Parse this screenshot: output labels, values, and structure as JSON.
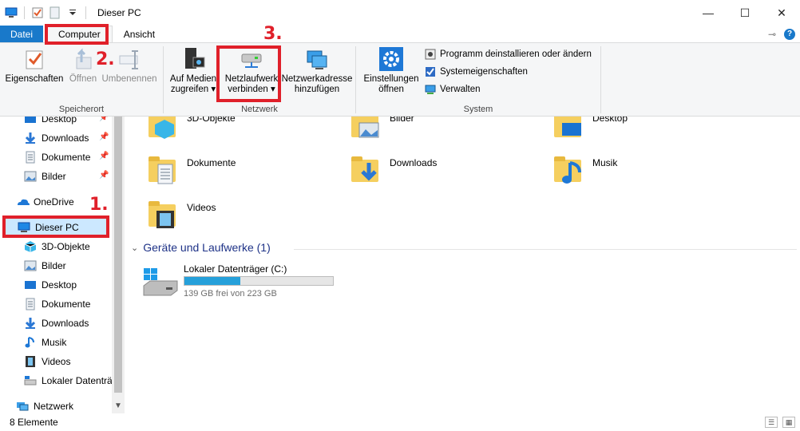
{
  "window": {
    "title": "Dieser PC",
    "controls": [
      "—",
      "☐",
      "✕"
    ]
  },
  "tabs": {
    "file": "Datei",
    "computer": "Computer",
    "view": "Ansicht"
  },
  "ribbon": {
    "location": {
      "label": "Speicherort",
      "properties": "Eigenschaften",
      "open": "Öffnen",
      "rename": "Umbenennen"
    },
    "network": {
      "label": "Netzwerk",
      "media_line1": "Auf Medien",
      "media_line2": "zugreifen",
      "map_line1": "Netzlaufwerk",
      "map_line2": "verbinden",
      "addr_line1": "Netzwerkadresse",
      "addr_line2": "hinzufügen"
    },
    "system": {
      "label": "System",
      "settings_line1": "Einstellungen",
      "settings_line2": "öffnen",
      "uninstall": "Programm deinstallieren oder ändern",
      "sysprops": "Systemeigenschaften",
      "manage": "Verwalten"
    }
  },
  "nav": {
    "quick": [
      {
        "label": "Desktop"
      },
      {
        "label": "Downloads"
      },
      {
        "label": "Dokumente"
      },
      {
        "label": "Bilder"
      }
    ],
    "onedrive": "OneDrive",
    "thispc": "Dieser PC",
    "pc_items": [
      {
        "label": "3D-Objekte"
      },
      {
        "label": "Bilder"
      },
      {
        "label": "Desktop"
      },
      {
        "label": "Dokumente"
      },
      {
        "label": "Downloads"
      },
      {
        "label": "Musik"
      },
      {
        "label": "Videos"
      },
      {
        "label": "Lokaler Datenträ"
      }
    ],
    "network": "Netzwerk"
  },
  "content": {
    "folders": [
      {
        "label": "3D-Objekte"
      },
      {
        "label": "Bilder"
      },
      {
        "label": "Desktop"
      },
      {
        "label": "Dokumente"
      },
      {
        "label": "Downloads"
      },
      {
        "label": "Musik"
      },
      {
        "label": "Videos"
      }
    ],
    "devices_header": "Geräte und Laufwerke (1)",
    "drive": {
      "name": "Lokaler Datenträger (C:)",
      "free_text": "139 GB frei von 223 GB",
      "used_fraction": 0.377
    }
  },
  "status": {
    "count": "8 Elemente"
  },
  "steps": {
    "s1": "1.",
    "s2": "2.",
    "s3": "3."
  },
  "colors": {
    "accent": "#1979ca",
    "highlight": "#e0202a",
    "selected": "#cce8ff",
    "drive_fill": "#26a0da"
  }
}
